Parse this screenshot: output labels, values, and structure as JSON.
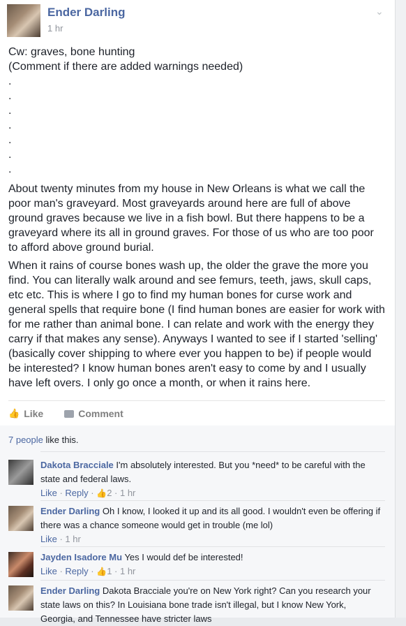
{
  "post": {
    "author": "Ender Darling",
    "time": "1 hr",
    "lines": [
      "Cw: graves, bone hunting",
      "(Comment if there are added warnings needed)"
    ],
    "dots": [
      ".",
      ".",
      ".",
      ".",
      ".",
      ".",
      "."
    ],
    "paragraph1": "About twenty minutes from my house in New Orleans is what we call the poor man's graveyard. Most graveyards around here are full of above ground graves because we live in a fish bowl. But there happens to be a graveyard where its all in ground graves. For those of us who are too poor to afford above ground burial.",
    "paragraph2": "When it rains of course bones wash up, the older the grave the more you find. You can literally walk around and see femurs, teeth, jaws, skull caps, etc etc. This is where I go to find my human bones for curse work and general spells that require bone (I find human bones are easier for work with for me rather than animal bone. I can relate and work with the energy they carry if that makes any sense). Anyways I wanted to see if I started 'selling' (basically cover shipping to where ever you happen to be) if people would be interested? I know human bones aren't easy to come by and I usually have left overs. I only go once a month, or when it rains here."
  },
  "actions": {
    "like_label": "Like",
    "comment_label": "Comment"
  },
  "likes": {
    "count_text": "7 people",
    "suffix": " like this."
  },
  "comments": [
    {
      "name": "Dakota Bracciale",
      "text": "I'm absolutely interested. But you *need* to be careful with the state and federal laws.",
      "like": "Like",
      "reply": "Reply",
      "likes": "2",
      "time": "1 hr"
    },
    {
      "name": "Ender Darling",
      "text": "Oh I know, I looked it up and its all good. I wouldn't even be offering if there was a chance someone would get in trouble (me lol)",
      "like": "Like",
      "reply": "",
      "likes": "",
      "time": "1 hr"
    },
    {
      "name": "Jayden Isadore Mu",
      "text": "Yes I would def be interested!",
      "like": "Like",
      "reply": "Reply",
      "likes": "1",
      "time": "1 hr"
    },
    {
      "name": "Ender Darling",
      "text": "Dakota Bracciale you're on New York right? Can you research your state laws on this? In Louisiana bone trade isn't illegal, but I know New York, Georgia, and Tennessee have stricter laws",
      "like": "",
      "reply": "",
      "likes": "",
      "time": ""
    }
  ]
}
